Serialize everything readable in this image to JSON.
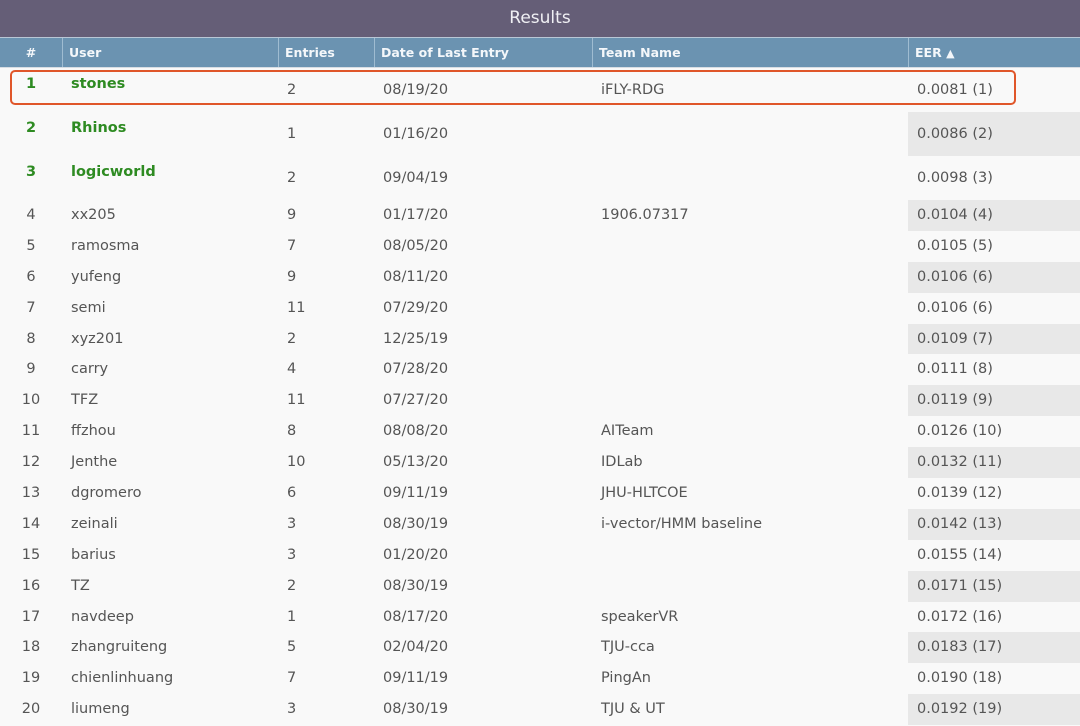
{
  "title": "Results",
  "columns": [
    "#",
    "User",
    "Entries",
    "Date of Last Entry",
    "Team Name",
    "EER"
  ],
  "sort_indicator": "▲",
  "colors": {
    "title_bar": "#655e77",
    "header": "#6b93b1",
    "top3_text": "#2e8b22",
    "highlight": "#e0562a"
  },
  "rows": [
    {
      "rank": "1",
      "user": "stones",
      "entries": "2",
      "date": "08/19/20",
      "team": "iFLY-RDG",
      "eer": "0.0081 (1)"
    },
    {
      "rank": "2",
      "user": "Rhinos",
      "entries": "1",
      "date": "01/16/20",
      "team": "",
      "eer": "0.0086 (2)"
    },
    {
      "rank": "3",
      "user": "logicworld",
      "entries": "2",
      "date": "09/04/19",
      "team": "",
      "eer": "0.0098 (3)"
    },
    {
      "rank": "4",
      "user": "xx205",
      "entries": "9",
      "date": "01/17/20",
      "team": "1906.07317",
      "eer": "0.0104 (4)"
    },
    {
      "rank": "5",
      "user": "ramosma",
      "entries": "7",
      "date": "08/05/20",
      "team": "",
      "eer": "0.0105 (5)"
    },
    {
      "rank": "6",
      "user": "yufeng",
      "entries": "9",
      "date": "08/11/20",
      "team": "",
      "eer": "0.0106 (6)"
    },
    {
      "rank": "7",
      "user": "semi",
      "entries": "11",
      "date": "07/29/20",
      "team": "",
      "eer": "0.0106 (6)"
    },
    {
      "rank": "8",
      "user": "xyz201",
      "entries": "2",
      "date": "12/25/19",
      "team": "",
      "eer": "0.0109 (7)"
    },
    {
      "rank": "9",
      "user": "carry",
      "entries": "4",
      "date": "07/28/20",
      "team": "",
      "eer": "0.0111 (8)"
    },
    {
      "rank": "10",
      "user": "TFZ",
      "entries": "11",
      "date": "07/27/20",
      "team": "",
      "eer": "0.0119 (9)"
    },
    {
      "rank": "11",
      "user": "ffzhou",
      "entries": "8",
      "date": "08/08/20",
      "team": "AITeam",
      "eer": "0.0126 (10)"
    },
    {
      "rank": "12",
      "user": "Jenthe",
      "entries": "10",
      "date": "05/13/20",
      "team": "IDLab",
      "eer": "0.0132 (11)"
    },
    {
      "rank": "13",
      "user": "dgromero",
      "entries": "6",
      "date": "09/11/19",
      "team": "JHU-HLTCOE",
      "eer": "0.0139 (12)"
    },
    {
      "rank": "14",
      "user": "zeinali",
      "entries": "3",
      "date": "08/30/19",
      "team": "i-vector/HMM baseline",
      "eer": "0.0142 (13)"
    },
    {
      "rank": "15",
      "user": "barius",
      "entries": "3",
      "date": "01/20/20",
      "team": "",
      "eer": "0.0155 (14)"
    },
    {
      "rank": "16",
      "user": "TZ",
      "entries": "2",
      "date": "08/30/19",
      "team": "",
      "eer": "0.0171 (15)"
    },
    {
      "rank": "17",
      "user": "navdeep",
      "entries": "1",
      "date": "08/17/20",
      "team": "speakerVR",
      "eer": "0.0172 (16)"
    },
    {
      "rank": "18",
      "user": "zhangruiteng",
      "entries": "5",
      "date": "02/04/20",
      "team": "TJU-cca",
      "eer": "0.0183 (17)"
    },
    {
      "rank": "19",
      "user": "chienlinhuang",
      "entries": "7",
      "date": "09/11/19",
      "team": "PingAn",
      "eer": "0.0190 (18)"
    },
    {
      "rank": "20",
      "user": "liumeng",
      "entries": "3",
      "date": "08/30/19",
      "team": "TJU & UT",
      "eer": "0.0192 (19)"
    }
  ]
}
